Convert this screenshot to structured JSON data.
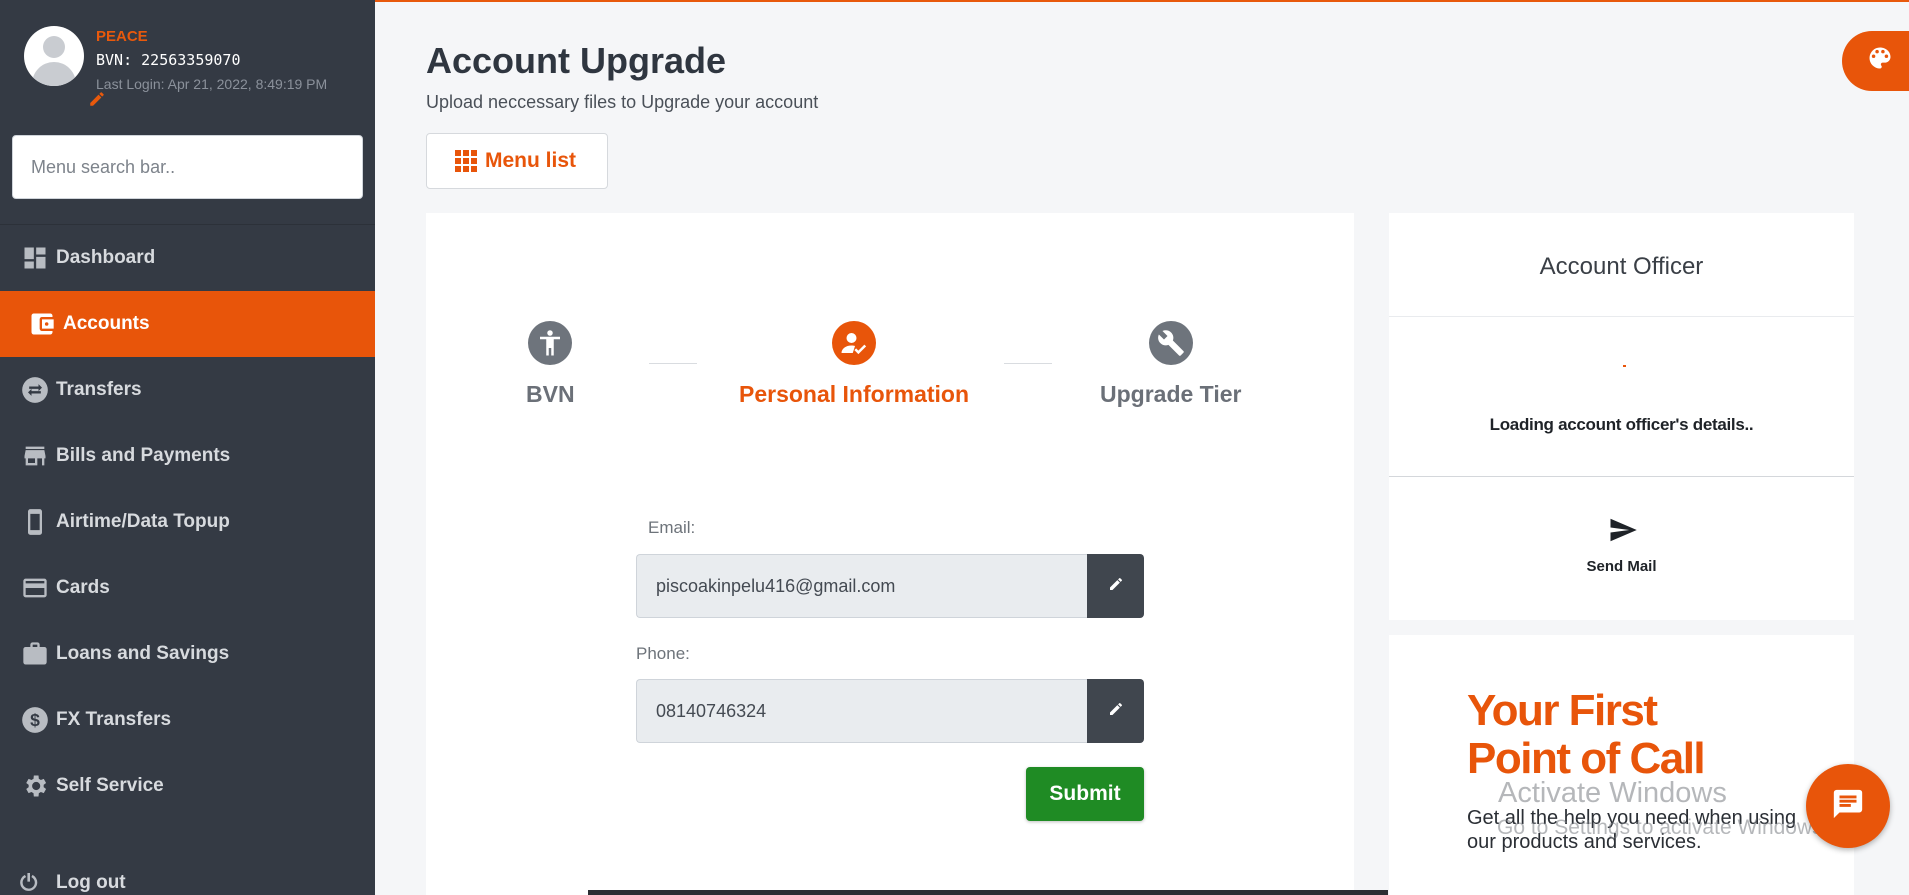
{
  "profile": {
    "name": "PEACE",
    "bvn": "BVN: 22563359070",
    "last_login": "Last Login: Apr 21, 2022, 8:49:19 PM"
  },
  "sidebar": {
    "search_placeholder": "Menu search bar..",
    "items": [
      {
        "label": "Dashboard",
        "icon": "dashboard-icon"
      },
      {
        "label": "Accounts",
        "icon": "wallet-icon",
        "active": true
      },
      {
        "label": "Transfers",
        "icon": "transfer-icon"
      },
      {
        "label": "Bills and Payments",
        "icon": "store-icon"
      },
      {
        "label": "Airtime/Data Topup",
        "icon": "phone-icon"
      },
      {
        "label": "Cards",
        "icon": "card-icon"
      },
      {
        "label": "Loans and Savings",
        "icon": "briefcase-icon"
      },
      {
        "label": "FX Transfers",
        "icon": "dollar-icon"
      },
      {
        "label": "Self Service",
        "icon": "gear-icon"
      }
    ],
    "logout_label": "Log out"
  },
  "header": {
    "title": "Account Upgrade",
    "subtitle": "Upload neccessary files to Upgrade your account",
    "menu_list_label": "Menu list"
  },
  "steps": [
    {
      "label": "BVN",
      "icon": "accessibility-icon"
    },
    {
      "label": "Personal Information",
      "icon": "user-check-icon",
      "active": true
    },
    {
      "label": "Upgrade Tier",
      "icon": "wrench-icon"
    }
  ],
  "form": {
    "email_label": "Email:",
    "email_value": "piscoakinpelu416@gmail.com",
    "phone_label": "Phone:",
    "phone_value": "08140746324",
    "submit_label": "Submit"
  },
  "officer": {
    "title": "Account Officer",
    "loading_text": "Loading account officer's details..",
    "send_mail_label": "Send Mail"
  },
  "promo": {
    "title_line1": "Your First",
    "title_line2": "Point of Call",
    "text": "Get all the help you need when using our products and services."
  },
  "watermark": {
    "line1": "Activate Windows",
    "line2": "Go to Settings to activate Windows."
  },
  "colors": {
    "accent": "#e8550a",
    "sidebar_bg": "#343a44",
    "submit_green": "#1f8b24"
  }
}
